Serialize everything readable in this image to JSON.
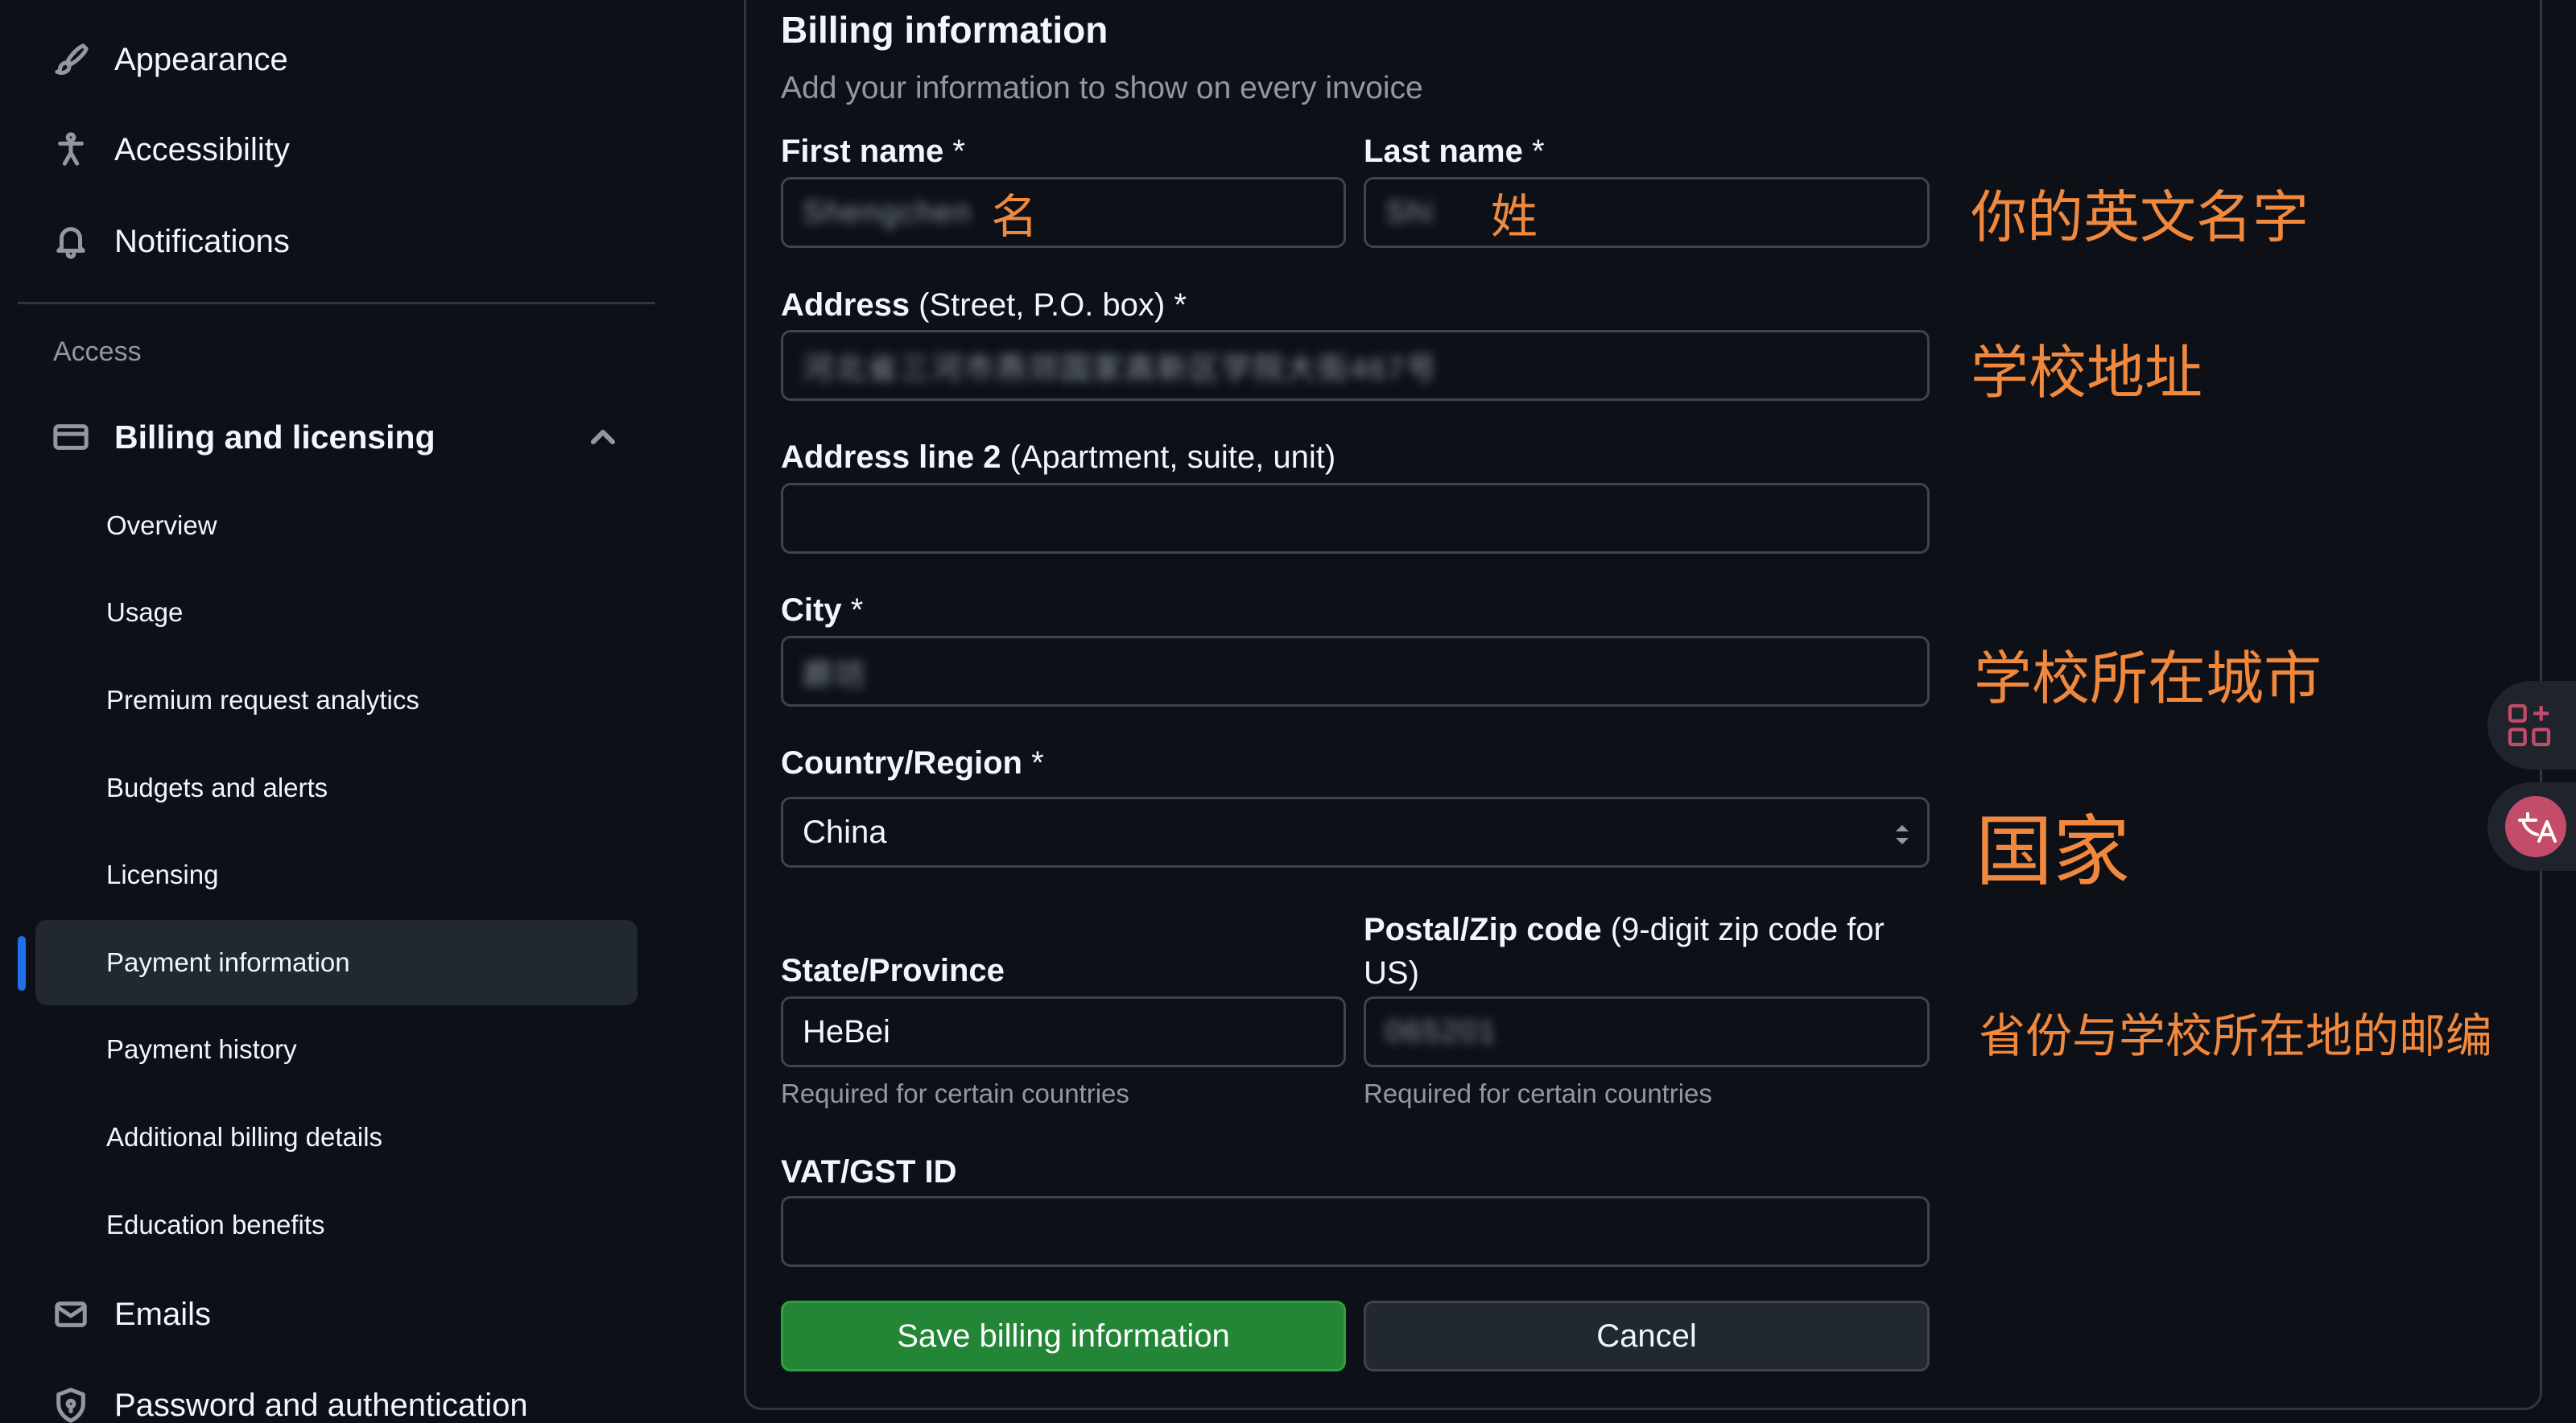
{
  "sidebar": {
    "top_items": [
      {
        "label": "Appearance",
        "icon": "paintbrush-icon"
      },
      {
        "label": "Accessibility",
        "icon": "accessibility-icon"
      },
      {
        "label": "Notifications",
        "icon": "bell-icon"
      }
    ],
    "group_label": "Access",
    "billing": {
      "label": "Billing and licensing",
      "icon": "credit-card-icon",
      "expanded": true
    },
    "sub_items": [
      {
        "label": "Overview"
      },
      {
        "label": "Usage"
      },
      {
        "label": "Premium request analytics"
      },
      {
        "label": "Budgets and alerts"
      },
      {
        "label": "Licensing"
      },
      {
        "label": "Payment information",
        "active": true
      },
      {
        "label": "Payment history"
      },
      {
        "label": "Additional billing details"
      },
      {
        "label": "Education benefits"
      }
    ],
    "bottom_items": [
      {
        "label": "Emails",
        "icon": "mail-icon"
      },
      {
        "label": "Password and authentication",
        "icon": "shield-lock-icon"
      }
    ]
  },
  "form": {
    "title": "Billing information",
    "subtitle": "Add your information to show on every invoice",
    "first_name": {
      "label": "First name",
      "required_mark": " *",
      "value": "Shengchen",
      "note": "名"
    },
    "last_name": {
      "label": "Last name",
      "required_mark": " *",
      "value": "Shi",
      "note": "姓"
    },
    "address": {
      "label": "Address",
      "hint": " (Street, P.O. box)",
      "required_mark": " *",
      "value": "河北省三河市燕郊国家高新区学院大街467号"
    },
    "address2": {
      "label": "Address line 2",
      "hint": " (Apartment, suite, unit)",
      "value": ""
    },
    "city": {
      "label": "City",
      "required_mark": " *",
      "value": "廊坊"
    },
    "country": {
      "label": "Country/Region",
      "required_mark": " *",
      "value": "China"
    },
    "state": {
      "label": "State/Province",
      "value": "HeBei",
      "helper": "Required for certain countries"
    },
    "postal": {
      "label": "Postal/Zip code",
      "hint_line1": " (9-digit zip code for",
      "hint_line2": "US)",
      "value": "065201",
      "helper": "Required for certain countries"
    },
    "vat": {
      "label": "VAT/GST ID",
      "value": ""
    },
    "save_label": "Save billing information",
    "cancel_label": "Cancel"
  },
  "annotations": {
    "name": "你的英文名字",
    "address": "学校地址",
    "city": "学校所在城市",
    "country": "国家",
    "state_postal": "省份与学校所在地的邮编"
  },
  "colors": {
    "background": "#0d1117",
    "accent": "#1f6feb",
    "save_button": "#238636",
    "annotation": "#f0883e"
  }
}
